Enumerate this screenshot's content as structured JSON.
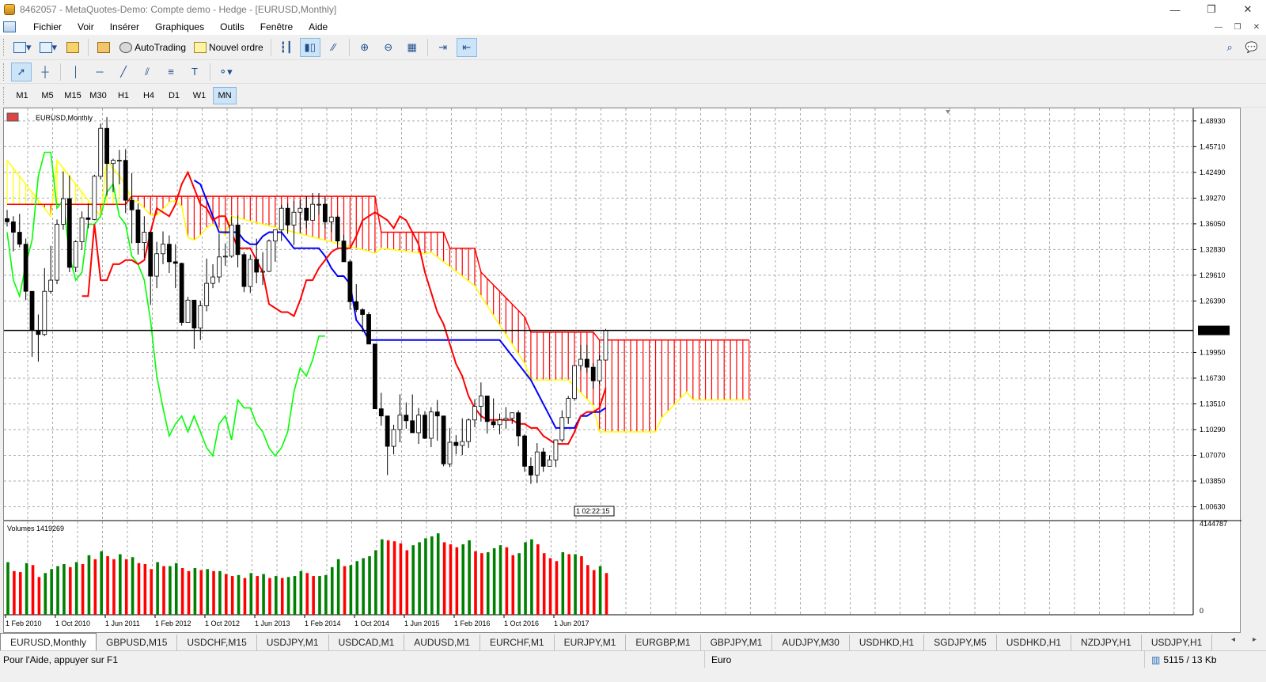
{
  "window": {
    "title": "8462057 - MetaQuotes-Demo: Compte demo - Hedge - [EURUSD,Monthly]",
    "controls": [
      "—",
      "❐",
      "✕"
    ]
  },
  "menu": [
    "Fichier",
    "Voir",
    "Insérer",
    "Graphiques",
    "Outils",
    "Fenêtre",
    "Aide"
  ],
  "mdi_controls": [
    "—",
    "❐",
    "✕"
  ],
  "toolbar": {
    "autotrading_label": "AutoTrading",
    "new_order_label": "Nouvel ordre"
  },
  "timeframes": [
    "M1",
    "M5",
    "M15",
    "M30",
    "H1",
    "H4",
    "D1",
    "W1",
    "MN"
  ],
  "active_timeframe": "MN",
  "chart": {
    "symbol_label": "EURUSD,Monthly",
    "volume_label": "Volumes 1419269",
    "current_price": "1.22710",
    "timer": "1 02:22:15",
    "price_ticks": [
      "1.48930",
      "1.45710",
      "1.42490",
      "1.39270",
      "1.36050",
      "1.32830",
      "1.29610",
      "1.26390",
      "1.19950",
      "1.16730",
      "1.13510",
      "1.10290",
      "1.07070",
      "1.03850",
      "1.00630"
    ],
    "volume_ticks": [
      "4144787",
      "0"
    ],
    "date_ticks": [
      "1 Feb 2010",
      "1 Oct 2010",
      "1 Jun 2011",
      "1 Feb 2012",
      "1 Oct 2012",
      "1 Jun 2013",
      "1 Feb 2014",
      "1 Oct 2014",
      "1 Jun 2015",
      "1 Feb 2016",
      "1 Oct 2016",
      "1 Jun 2017"
    ],
    "colors": {
      "bull": "#ffffff",
      "bear": "#000000",
      "tenkan": "#ff0000",
      "kijun": "#0000ff",
      "chikou": "#00ff00",
      "senkou_a": "#ffff00",
      "senkou_b": "#ff0000",
      "vol_up": "#008000",
      "vol_down": "#ff0000"
    }
  },
  "chart_data": {
    "type": "candlestick",
    "series": [
      {
        "name": "EURUSD,Monthly",
        "ohlc": [
          [
            1.367,
            1.378,
            1.357,
            1.363
          ],
          [
            1.363,
            1.37,
            1.326,
            1.35
          ],
          [
            1.35,
            1.373,
            1.331,
            1.335
          ],
          [
            1.335,
            1.342,
            1.265,
            1.276
          ],
          [
            1.276,
            1.276,
            1.194,
            1.227
          ],
          [
            1.227,
            1.247,
            1.188,
            1.222
          ],
          [
            1.222,
            1.305,
            1.22,
            1.276
          ],
          [
            1.276,
            1.333,
            1.273,
            1.29
          ],
          [
            1.29,
            1.366,
            1.285,
            1.36
          ],
          [
            1.36,
            1.426,
            1.353,
            1.392
          ],
          [
            1.392,
            1.421,
            1.3,
            1.306
          ],
          [
            1.306,
            1.34,
            1.3,
            1.338
          ],
          [
            1.338,
            1.376,
            1.328,
            1.368
          ],
          [
            1.368,
            1.386,
            1.355,
            1.366
          ],
          [
            1.366,
            1.422,
            1.365,
            1.42
          ],
          [
            1.42,
            1.486,
            1.416,
            1.48
          ],
          [
            1.48,
            1.494,
            1.396,
            1.436
          ],
          [
            1.436,
            1.442,
            1.4,
            1.44
          ],
          [
            1.44,
            1.453,
            1.41,
            1.44
          ],
          [
            1.44,
            1.454,
            1.374,
            1.39
          ],
          [
            1.39,
            1.424,
            1.336,
            1.378
          ],
          [
            1.378,
            1.386,
            1.322,
            1.337
          ],
          [
            1.337,
            1.37,
            1.318,
            1.35
          ],
          [
            1.35,
            1.351,
            1.259,
            1.295
          ],
          [
            1.295,
            1.338,
            1.28,
            1.323
          ],
          [
            1.323,
            1.351,
            1.31,
            1.335
          ],
          [
            1.335,
            1.346,
            1.299,
            1.313
          ],
          [
            1.313,
            1.335,
            1.28,
            1.311
          ],
          [
            1.311,
            1.312,
            1.233,
            1.237
          ],
          [
            1.237,
            1.269,
            1.237,
            1.265
          ],
          [
            1.265,
            1.265,
            1.204,
            1.23
          ],
          [
            1.23,
            1.264,
            1.215,
            1.258
          ],
          [
            1.258,
            1.317,
            1.251,
            1.286
          ],
          [
            1.286,
            1.31,
            1.28,
            1.294
          ],
          [
            1.294,
            1.348,
            1.287,
            1.319
          ],
          [
            1.319,
            1.336,
            1.308,
            1.32
          ],
          [
            1.32,
            1.37,
            1.318,
            1.359
          ],
          [
            1.359,
            1.371,
            1.306,
            1.322
          ],
          [
            1.322,
            1.325,
            1.275,
            1.282
          ],
          [
            1.282,
            1.322,
            1.274,
            1.316
          ],
          [
            1.316,
            1.342,
            1.286,
            1.3
          ],
          [
            1.3,
            1.325,
            1.284,
            1.301
          ],
          [
            1.301,
            1.341,
            1.3,
            1.339
          ],
          [
            1.339,
            1.343,
            1.313,
            1.353
          ],
          [
            1.353,
            1.384,
            1.339,
            1.38
          ],
          [
            1.38,
            1.386,
            1.348,
            1.359
          ],
          [
            1.359,
            1.389,
            1.334,
            1.375
          ],
          [
            1.375,
            1.39,
            1.349,
            1.38
          ],
          [
            1.38,
            1.395,
            1.355,
            1.365
          ],
          [
            1.365,
            1.399,
            1.366,
            1.385
          ],
          [
            1.385,
            1.399,
            1.372,
            1.385
          ],
          [
            1.385,
            1.394,
            1.355,
            1.363
          ],
          [
            1.363,
            1.37,
            1.35,
            1.369
          ],
          [
            1.369,
            1.371,
            1.331,
            1.339
          ],
          [
            1.339,
            1.347,
            1.313,
            1.313
          ],
          [
            1.313,
            1.316,
            1.253,
            1.263
          ],
          [
            1.263,
            1.285,
            1.25,
            1.253
          ],
          [
            1.253,
            1.255,
            1.225,
            1.247
          ],
          [
            1.247,
            1.25,
            1.212,
            1.21
          ],
          [
            1.21,
            1.21,
            1.129,
            1.129
          ],
          [
            1.129,
            1.149,
            1.108,
            1.12
          ],
          [
            1.12,
            1.12,
            1.046,
            1.082
          ],
          [
            1.082,
            1.109,
            1.072,
            1.103
          ],
          [
            1.103,
            1.147,
            1.087,
            1.121
          ],
          [
            1.121,
            1.137,
            1.104,
            1.114
          ],
          [
            1.114,
            1.147,
            1.105,
            1.099
          ],
          [
            1.099,
            1.13,
            1.085,
            1.121
          ],
          [
            1.121,
            1.126,
            1.091,
            1.092
          ],
          [
            1.092,
            1.131,
            1.081,
            1.125
          ],
          [
            1.125,
            1.14,
            1.089,
            1.12
          ],
          [
            1.12,
            1.12,
            1.057,
            1.06
          ],
          [
            1.06,
            1.105,
            1.056,
            1.087
          ],
          [
            1.087,
            1.096,
            1.072,
            1.083
          ],
          [
            1.083,
            1.117,
            1.071,
            1.088
          ],
          [
            1.088,
            1.117,
            1.08,
            1.115
          ],
          [
            1.115,
            1.141,
            1.106,
            1.132
          ],
          [
            1.132,
            1.162,
            1.113,
            1.145
          ],
          [
            1.145,
            1.142,
            1.098,
            1.113
          ],
          [
            1.113,
            1.142,
            1.105,
            1.109
          ],
          [
            1.109,
            1.123,
            1.097,
            1.115
          ],
          [
            1.115,
            1.131,
            1.104,
            1.117
          ],
          [
            1.117,
            1.124,
            1.11,
            1.124
          ],
          [
            1.124,
            1.127,
            1.082,
            1.095
          ],
          [
            1.095,
            1.097,
            1.05,
            1.057
          ],
          [
            1.057,
            1.068,
            1.035,
            1.046
          ],
          [
            1.046,
            1.086,
            1.036,
            1.075
          ],
          [
            1.075,
            1.08,
            1.05,
            1.057
          ],
          [
            1.057,
            1.071,
            1.06,
            1.065
          ],
          [
            1.065,
            1.09,
            1.056,
            1.09
          ],
          [
            1.09,
            1.127,
            1.087,
            1.118
          ],
          [
            1.118,
            1.145,
            1.11,
            1.142
          ],
          [
            1.142,
            1.184,
            1.139,
            1.183
          ],
          [
            1.183,
            1.209,
            1.177,
            1.191
          ],
          [
            1.191,
            1.209,
            1.174,
            1.181
          ],
          [
            1.181,
            1.186,
            1.154,
            1.164
          ],
          [
            1.164,
            1.196,
            1.16,
            1.19
          ],
          [
            1.19,
            1.229,
            1.192,
            1.227
          ]
        ]
      },
      {
        "name": "Volumes",
        "values": [
          2650,
          2200,
          2150,
          2600,
          2500,
          1900,
          2100,
          2300,
          2450,
          2550,
          2400,
          2650,
          2550,
          3000,
          2800,
          3200,
          2950,
          2800,
          3050,
          2800,
          2900,
          2600,
          2550,
          2300,
          2650,
          2450,
          2450,
          2600,
          2350,
          2200,
          2350,
          2250,
          2300,
          2200,
          2200,
          2050,
          1950,
          2000,
          1850,
          2100,
          1950,
          2050,
          1850,
          1950,
          1850,
          1900,
          1950,
          2200,
          2100,
          1950,
          1950,
          2000,
          2400,
          2800,
          2450,
          2500,
          2700,
          2850,
          2950,
          3250,
          3800,
          3750,
          3700,
          3600,
          3250,
          3500,
          3650,
          3850,
          3950,
          4100,
          3650,
          3550,
          3400,
          3550,
          3750,
          3200,
          3100,
          3150,
          3350,
          3500,
          3400,
          3000,
          3100,
          3650,
          3800,
          3550,
          3100,
          2850,
          2700,
          3150,
          3050,
          3050,
          2950,
          2500,
          2250,
          2450,
          2100
        ]
      }
    ],
    "y_range": [
      1.0063,
      1.4893
    ],
    "tenkan": [
      1.27,
      1.27,
      1.36,
      1.29,
      1.29,
      1.31,
      1.31,
      1.315,
      1.315,
      1.31,
      1.315,
      1.35,
      1.38,
      1.375,
      1.37,
      1.385,
      1.41,
      1.425,
      1.405,
      1.385,
      1.38,
      1.365,
      1.37,
      1.37,
      1.35,
      1.33,
      1.33,
      1.33,
      1.315,
      1.3,
      1.26,
      1.255,
      1.25,
      1.25,
      1.245,
      1.265,
      1.29,
      1.29,
      1.305,
      1.315,
      1.325,
      1.33,
      1.33,
      1.33,
      1.345,
      1.365,
      1.37,
      1.375,
      1.37,
      1.365,
      1.355,
      1.37,
      1.365,
      1.35,
      1.335,
      1.3,
      1.275,
      1.25,
      1.235,
      1.21,
      1.185,
      1.17,
      1.145,
      1.13,
      1.12,
      1.115,
      1.115,
      1.115,
      1.115,
      1.115,
      1.11,
      1.11,
      1.105,
      1.105,
      1.095,
      1.09,
      1.085,
      1.085,
      1.085,
      1.1,
      1.12,
      1.125,
      1.125,
      1.13,
      1.155
    ],
    "kijun": [
      1.415,
      1.41,
      1.39,
      1.37,
      1.35,
      1.35,
      1.35,
      1.35,
      1.34,
      1.335,
      1.335,
      1.345,
      1.35,
      1.35,
      1.35,
      1.34,
      1.33,
      1.33,
      1.33,
      1.33,
      1.33,
      1.32,
      1.305,
      1.295,
      1.295,
      1.285,
      1.24,
      1.23,
      1.215,
      1.215,
      1.215,
      1.215,
      1.215,
      1.215,
      1.215,
      1.215,
      1.215,
      1.215,
      1.215,
      1.215,
      1.215,
      1.215,
      1.215,
      1.215,
      1.215,
      1.215,
      1.215,
      1.215,
      1.215,
      1.215,
      1.205,
      1.195,
      1.185,
      1.175,
      1.165,
      1.15,
      1.135,
      1.12,
      1.105,
      1.105,
      1.105,
      1.105,
      1.12,
      1.12,
      1.125,
      1.125,
      1.13
    ],
    "chikou": [
      1.35,
      1.29,
      1.27,
      1.31,
      1.34,
      1.42,
      1.45,
      1.45,
      1.38,
      1.39,
      1.32,
      1.29,
      1.3,
      1.36,
      1.36,
      1.37,
      1.4,
      1.41,
      1.37,
      1.36,
      1.32,
      1.31,
      1.29,
      1.24,
      1.17,
      1.13,
      1.095,
      1.11,
      1.12,
      1.1,
      1.12,
      1.1,
      1.08,
      1.07,
      1.11,
      1.12,
      1.09,
      1.14,
      1.13,
      1.13,
      1.11,
      1.1,
      1.08,
      1.07,
      1.08,
      1.1,
      1.15,
      1.18,
      1.17,
      1.19,
      1.22,
      1.22
    ]
  }
}
